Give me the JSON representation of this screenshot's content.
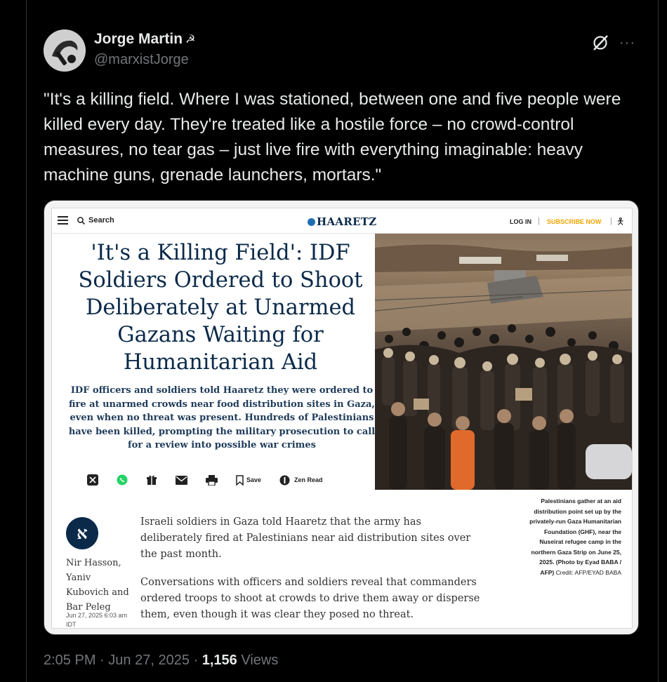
{
  "tweet": {
    "display_name": "Jorge Martin",
    "name_emoji": "☭",
    "handle": "@marxistJorge",
    "text": "\"It's a killing field. Where I was stationed, between one and five people were killed every day. They're treated like a hostile force – no crowd-control measures, no tear gas – just live fire with everything imaginable: heavy machine guns, grenade launchers, mortars.\"",
    "time": "2:05 PM",
    "date": "Jun 27, 2025",
    "views_count": "1,156",
    "views_label": "Views",
    "separator": "·"
  },
  "article": {
    "search_label": "Search",
    "logo": "HAARETZ",
    "login": "LOG IN",
    "subscribe": "SUBSCRIBE NOW",
    "headline": "'It's a Killing Field': IDF Soldiers Ordered to Shoot Deliberately at Unarmed Gazans Waiting for Humanitarian Aid",
    "subhead": "IDF officers and soldiers told Haaretz they were ordered to fire at unarmed crowds near food distribution sites in Gaza, even when no threat was present. Hundreds of Palestinians have been killed, prompting the military prosecution to call for a review into possible war crimes",
    "share": {
      "save_label": "Save",
      "zen_label": "Zen Read"
    },
    "caption": "Palestinians gather at an aid distribution point set up by the privately-run Gaza Humanitarian Foundation (GHF), near the Nuseirat refugee camp in the northern Gaza Strip on June 25, 2025. (Photo by Eyad BABA / AFP)",
    "caption_credit": "Credit: AFP/EYAD BABA",
    "author_logo": "א",
    "byline": "Nir Hasson, Yaniv Kubovich and Bar Peleg",
    "dateline": "Jun 27, 2025 6:03 am IDT",
    "paragraphs": [
      "Israeli soldiers in Gaza told Haaretz that the army has deliberately fired at Palestinians near aid distribution sites over the past month.",
      "Conversations with officers and soldiers reveal that commanders ordered troops to shoot at crowds to drive them away or disperse them, even though it was clear they posed no threat."
    ]
  },
  "colors": {
    "background": "#000000",
    "text": "#e7e9ea",
    "muted": "#71767b",
    "haaretz_navy": "#0b2a4a",
    "subscribe_gold": "#f0a500"
  },
  "icons": [
    "grok-icon",
    "more-icon",
    "menu-icon",
    "search-icon",
    "x-share-icon",
    "whatsapp-icon",
    "gift-icon",
    "mail-icon",
    "print-icon",
    "bookmark-icon",
    "zen-read-icon",
    "accessibility-icon"
  ]
}
